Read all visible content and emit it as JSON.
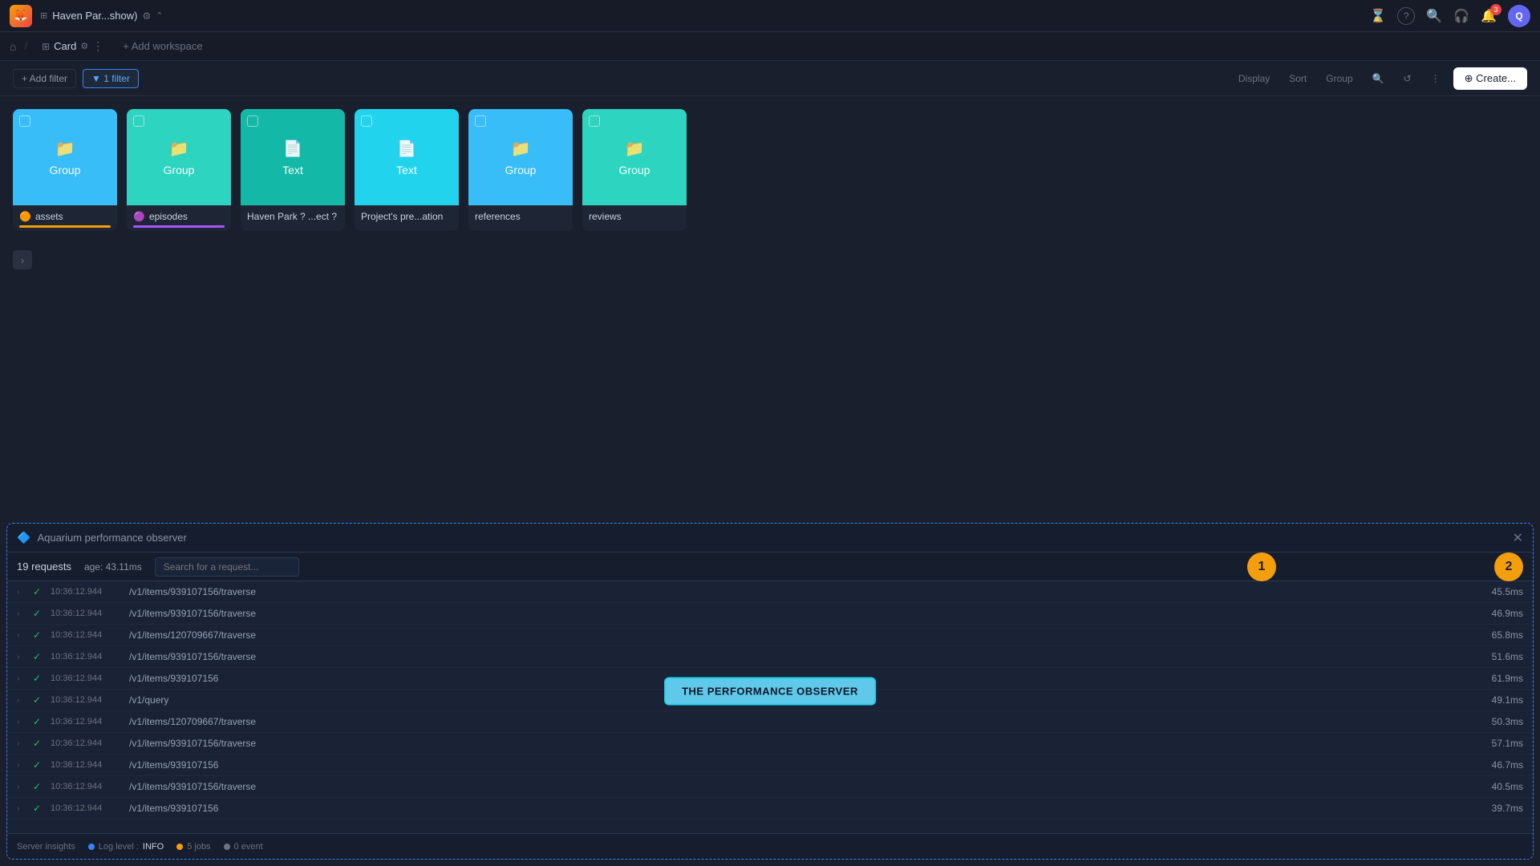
{
  "topbar": {
    "logo_emoji": "🦊",
    "workspace_icon": "⊞",
    "workspace_name": "Haven Par...show)",
    "settings_icon": "⚙",
    "chevron_icon": "⌃",
    "icons": {
      "hourglass": "⌛",
      "question": "?",
      "search": "🔍",
      "headphone": "🎧",
      "bell": "🔔",
      "bell_badge": "3",
      "avatar_label": "Q"
    }
  },
  "navbar": {
    "home_icon": "⌂",
    "card_icon": "⊞",
    "card_label": "Card",
    "card_settings": "⚙",
    "card_menu": "⋮",
    "add_workspace": "+ Add workspace"
  },
  "toolbar": {
    "add_filter": "+ Add filter",
    "active_filter": "▼ 1 filter",
    "display": "Display",
    "sort": "Sort",
    "group": "Group",
    "search_icon": "🔍",
    "refresh_icon": "↺",
    "menu_icon": "⋮",
    "create": "⊕ Create..."
  },
  "cards": [
    {
      "type": "Group",
      "type_icon": "📁",
      "name": "assets",
      "name_icon": "🟠",
      "color": "blue",
      "indicator_color": "#f59e0b"
    },
    {
      "type": "Group",
      "type_icon": "📁",
      "name": "episodes",
      "name_icon": "🟣",
      "color": "teal",
      "indicator_color": "#a855f7"
    },
    {
      "type": "Text",
      "type_icon": "📄",
      "name": "Haven Park ? ...ect ?",
      "name_icon": "",
      "color": "teal2",
      "indicator_color": ""
    },
    {
      "type": "Text",
      "type_icon": "📄",
      "name": "Project's pre...ation",
      "name_icon": "",
      "color": "cyan",
      "indicator_color": ""
    },
    {
      "type": "Group",
      "type_icon": "📁",
      "name": "references",
      "name_icon": "",
      "color": "blue2",
      "indicator_color": ""
    },
    {
      "type": "Group",
      "type_icon": "📁",
      "name": "reviews",
      "name_icon": "",
      "color": "teal3",
      "indicator_color": ""
    }
  ],
  "perf_observer": {
    "title": "Aquarium performance observer",
    "icon": "🔷",
    "close": "✕",
    "requests_count": "19 requests",
    "avg_label": "age: 43.11ms",
    "search_placeholder": "Search for a request...",
    "badge1": "1",
    "badge2": "2",
    "tooltip": "THE PERFORMANCE OBSERVER",
    "requests": [
      {
        "time": "10:36:12.944",
        "path": "/v1/items/939107156/traverse",
        "duration": "45.5ms"
      },
      {
        "time": "10:36:12.944",
        "path": "/v1/items/939107156/traverse",
        "duration": "46.9ms"
      },
      {
        "time": "10:36:12.944",
        "path": "/v1/items/120709667/traverse",
        "duration": "65.8ms"
      },
      {
        "time": "10:36:12.944",
        "path": "/v1/items/939107156/traverse",
        "duration": "51.6ms"
      },
      {
        "time": "10:36:12.944",
        "path": "/v1/items/939107156",
        "duration": "61.9ms"
      },
      {
        "time": "10:36:12.944",
        "path": "/v1/query",
        "duration": "49.1ms"
      },
      {
        "time": "10:36:12.944",
        "path": "/v1/items/120709667/traverse",
        "duration": "50.3ms"
      },
      {
        "time": "10:36:12.944",
        "path": "/v1/items/939107156/traverse",
        "duration": "57.1ms"
      },
      {
        "time": "10:36:12.944",
        "path": "/v1/items/939107156",
        "duration": "46.7ms"
      },
      {
        "time": "10:36:12.944",
        "path": "/v1/items/939107156/traverse",
        "duration": "40.5ms"
      },
      {
        "time": "10:36:12.944",
        "path": "/v1/items/939107156",
        "duration": "39.7ms"
      }
    ],
    "footer": {
      "server_insights": "Server insights",
      "log_label": "Log level :",
      "log_value": "INFO",
      "jobs_label": "5 jobs",
      "jobs_icon_color": "#f59e0b",
      "events_label": "0 event",
      "events_icon_color": "#6b7280"
    }
  }
}
